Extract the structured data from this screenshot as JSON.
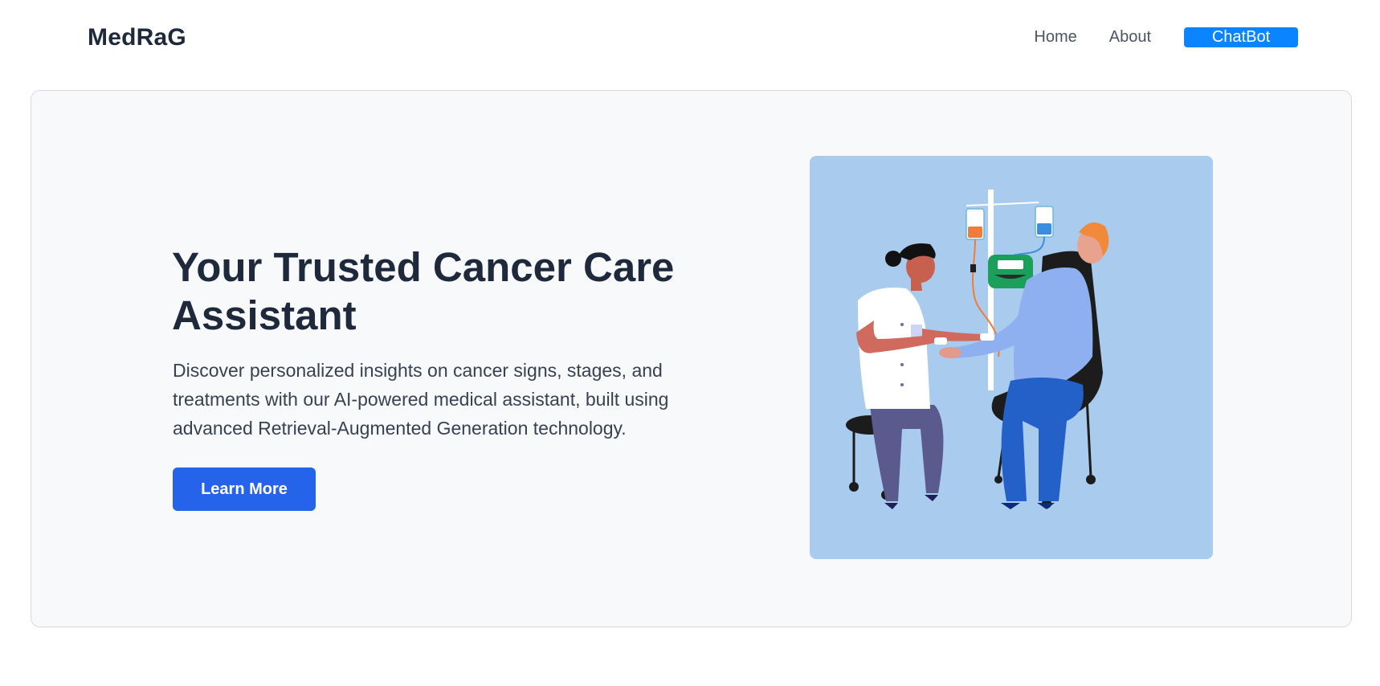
{
  "nav": {
    "brand": "MedRaG",
    "links": [
      {
        "label": "Home"
      },
      {
        "label": "About"
      }
    ],
    "cta": "ChatBot"
  },
  "hero": {
    "title": "Your Trusted Cancer Care Assistant",
    "description": "Discover personalized insights on cancer signs, stages, and treatments with our AI-powered medical assistant, built using advanced Retrieval-Augmented Generation technology.",
    "button": "Learn More"
  },
  "colors": {
    "brand_text": "#1e293b",
    "accent_blue": "#0a84ff",
    "button_blue": "#2563eb",
    "hero_bg": "#f8f9fb",
    "illustration_bg": "#a9cbee"
  },
  "illustration": {
    "icon": "chemotherapy-infusion-illustration"
  }
}
